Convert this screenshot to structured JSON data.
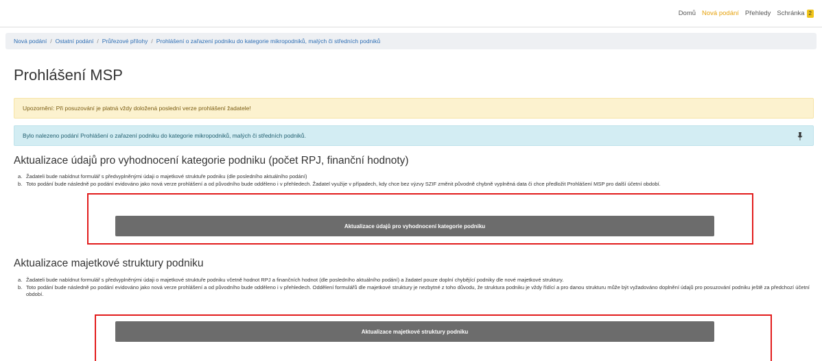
{
  "topnav": {
    "items": [
      {
        "label": "Domů",
        "active": false
      },
      {
        "label": "Nová podání",
        "active": true
      },
      {
        "label": "Přehledy",
        "active": false
      },
      {
        "label": "Schránka",
        "active": false
      }
    ],
    "inbox_badge": "2"
  },
  "breadcrumb": [
    "Nová podání",
    "Ostatní podání",
    "Průřezové přílohy",
    "Prohlášení o zařazení podniku do kategorie mikropodniků, malých či středních podniků"
  ],
  "page_title": "Prohlášení MSP",
  "alerts": {
    "warning": "Upozornění: Při posuzování je platná vždy doložená poslední verze prohlášení žadatele!",
    "info": "Bylo nalezeno podání Prohlášení o zařazení podniku do kategorie mikropodniků, malých či středních podniků.",
    "pin_icon": "pin-icon"
  },
  "sections": [
    {
      "title": "Aktualizace údajů pro vyhodnocení kategorie podniku (počet RPJ, finanční hodnoty)",
      "items": [
        {
          "marker": "a.",
          "text": "Žadateli bude nabídnut formulář s předvyplněnými údaji o majetkové struktuře podniku (dle posledního aktuálního podání)"
        },
        {
          "marker": "b.",
          "text": "Toto podání bude následně po podání evidováno jako nová verze prohlášení a od původního bude odděleno i v přehledech. Žadatel využije v případech, kdy chce bez výzvy SZIF změnit původně chybně vyplněná data či chce předložit Prohlášení MSP pro další účetní období."
        }
      ],
      "button_label": "Aktualizace údajů pro vyhodnocení kategorie podniku"
    },
    {
      "title": "Aktualizace majetkové struktury podniku",
      "items": [
        {
          "marker": "a.",
          "text": "Žadateli bude nabídnut formulář s předvyplněnými údaji o majetkové struktuře podniku včetně hodnot RPJ a finančních hodnot (dle posledního aktuálního podání) a žadatel pouze doplní chybějící podniky dle nové majetkové struktury."
        },
        {
          "marker": "b.",
          "text": "Toto podání bude následně po podání evidováno jako nová verze prohlášení a od původního bude odděleno i v přehledech. Oddělení formulářů dle majetkové struktury je nezbytné z toho důvodu, že struktura podniku je vždy řídící a pro danou strukturu může být vyžadováno doplnění údajů pro posuzování podniku ještě za předchozí účetní období."
        }
      ],
      "button_label": "Aktualizace majetkové struktury podniku"
    }
  ],
  "colors": {
    "highlight_box": "#e21b1b",
    "button_bg": "#6c6c6c",
    "accent": "#e6a10a",
    "link": "#2f6fb5"
  }
}
